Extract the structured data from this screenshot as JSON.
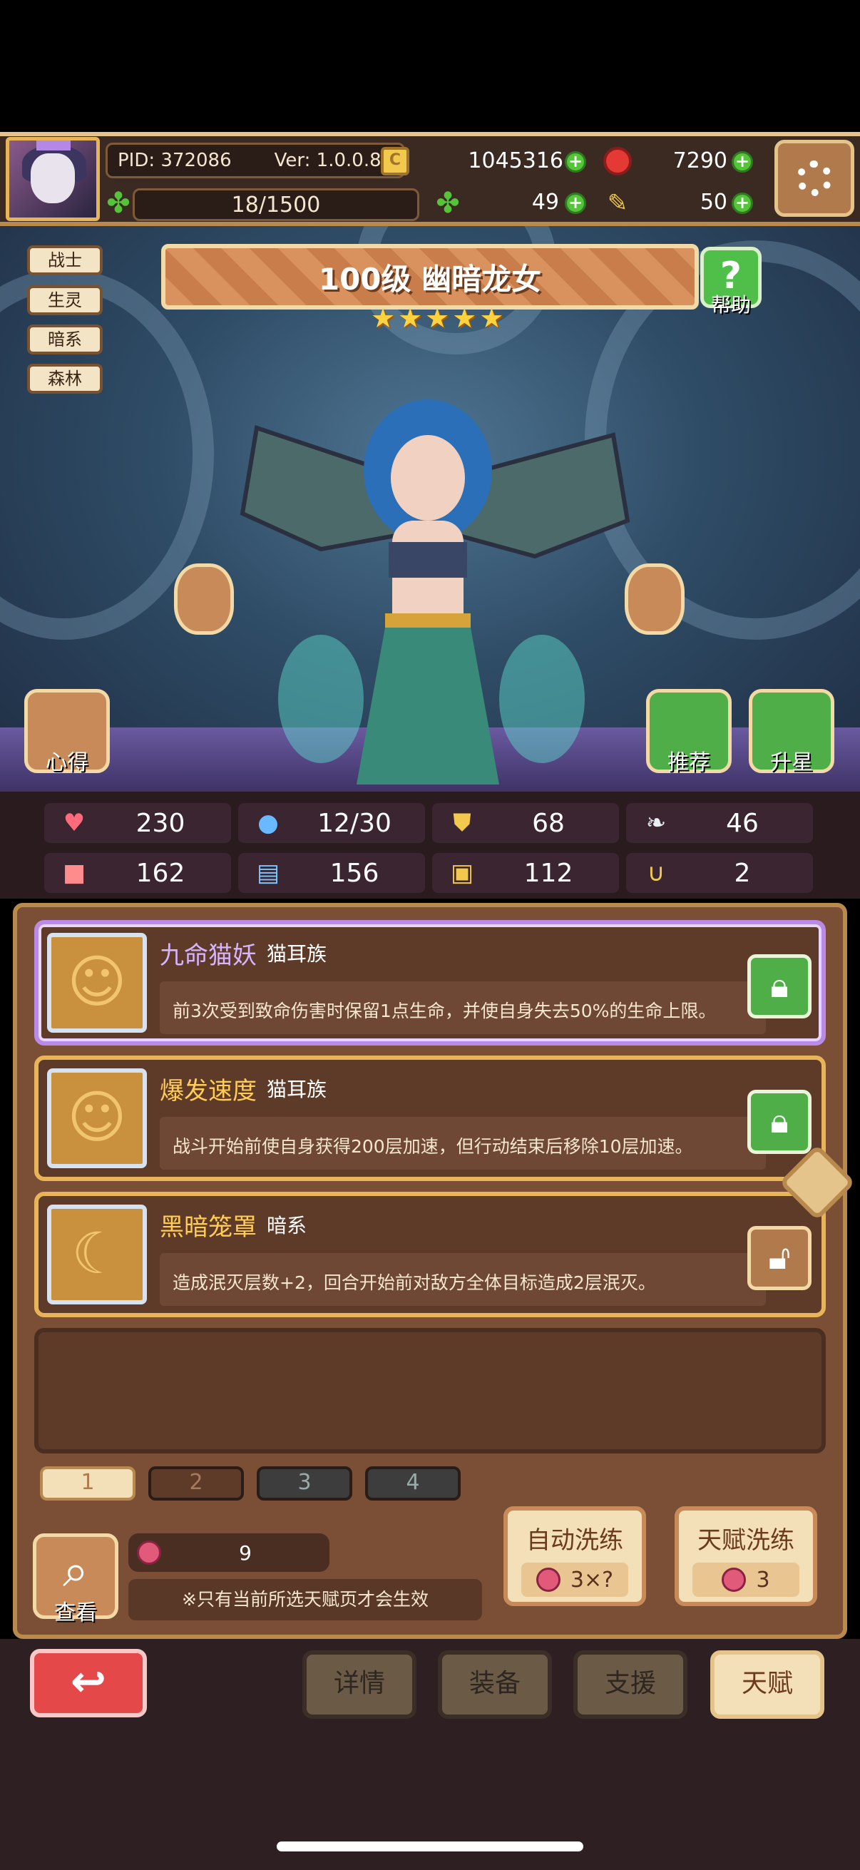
{
  "header": {
    "pid": "PID: 372086",
    "version": "Ver: 1.0.0.8",
    "gold": "1045316",
    "gems": "7290",
    "exp": "18/1500",
    "clover": "49",
    "tickets": "50"
  },
  "hero": {
    "tags": [
      "战士",
      "生灵",
      "暗系",
      "森林"
    ],
    "title": "100级 幽暗龙女",
    "stars": 5,
    "help_label": "帮助",
    "tips_label": "心得",
    "recommend_label": "推荐",
    "starup_label": "升星"
  },
  "stats": {
    "hp": "230",
    "mana": "12/30",
    "defense": "68",
    "speed": "46",
    "attack": "162",
    "magic": "156",
    "armor": "112",
    "luck": "2"
  },
  "talents": [
    {
      "name": "九命猫妖",
      "tribe": "猫耳族",
      "desc": "前3次受到致命伤害时保留1点生命，并使自身失去50%的生命上限。",
      "icon": "cat-icon",
      "locked": true
    },
    {
      "name": "爆发速度",
      "tribe": "猫耳族",
      "desc": "战斗开始前使自身获得200层加速，但行动结束后移除10层加速。",
      "icon": "cat-icon",
      "locked": true
    },
    {
      "name": "黑暗笼罩",
      "tribe": "暗系",
      "desc": "造成泯灭层数+2，回合开始前对敌方全体目标造成2层泯灭。",
      "icon": "moon-icon",
      "locked": false
    }
  ],
  "pages": [
    "1",
    "2",
    "3",
    "4"
  ],
  "controls": {
    "view_label": "查看",
    "fruit_count": "9",
    "note": "※只有当前所选天赋页才会生效",
    "auto_reroll_label": "自动洗练",
    "auto_reroll_cost": "3×?",
    "talent_reroll_label": "天赋洗练",
    "talent_reroll_cost": "3"
  },
  "nav": {
    "details": "详情",
    "equipment": "装备",
    "support": "支援",
    "talent": "天赋"
  },
  "colors": {
    "accent_gold": "#e8b45a",
    "panel_brown": "#7a4f35",
    "selected_purple": "#b98ae6",
    "confirm_green": "#4fae48",
    "back_red": "#e54848"
  }
}
